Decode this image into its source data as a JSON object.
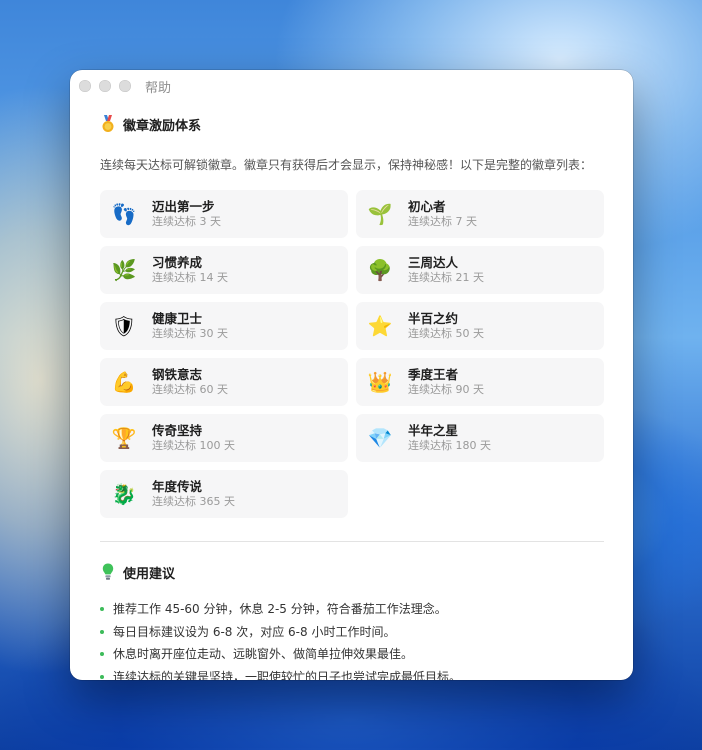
{
  "window": {
    "title": "帮助"
  },
  "badges_section": {
    "title": "徽章激励体系",
    "icon": "medal-icon",
    "intro": "连续每天达标可解锁徽章。徽章只有获得后才会显示，保持神秘感！以下是完整的徽章列表：",
    "items": [
      {
        "name": "迈出第一步",
        "requirement": "连续达标 3 天",
        "icon": "footprints-icon",
        "glyph": "👣"
      },
      {
        "name": "初心者",
        "requirement": "连续达标 7 天",
        "icon": "seedling-icon",
        "glyph": "🌱"
      },
      {
        "name": "习惯养成",
        "requirement": "连续达标 14 天",
        "icon": "herb-icon",
        "glyph": "🌿"
      },
      {
        "name": "三周达人",
        "requirement": "连续达标 21 天",
        "icon": "tree-icon",
        "glyph": "🌳"
      },
      {
        "name": "健康卫士",
        "requirement": "连续达标 30 天",
        "icon": "shield-icon",
        "glyph": "🛡"
      },
      {
        "name": "半百之约",
        "requirement": "连续达标 50 天",
        "icon": "star-icon",
        "glyph": "⭐"
      },
      {
        "name": "钢铁意志",
        "requirement": "连续达标 60 天",
        "icon": "flexed-biceps-icon",
        "glyph": "💪"
      },
      {
        "name": "季度王者",
        "requirement": "连续达标 90 天",
        "icon": "crown-icon",
        "glyph": "👑"
      },
      {
        "name": "传奇坚持",
        "requirement": "连续达标 100 天",
        "icon": "trophy-icon",
        "glyph": "🏆"
      },
      {
        "name": "半年之星",
        "requirement": "连续达标 180 天",
        "icon": "gem-icon",
        "glyph": "💎"
      },
      {
        "name": "年度传说",
        "requirement": "连续达标 365 天",
        "icon": "dragon-icon",
        "glyph": "🐉"
      }
    ]
  },
  "tips_section": {
    "title": "使用建议",
    "icon": "lightbulb-icon",
    "items": [
      "推荐工作 45-60 分钟，休息 2-5 分钟，符合番茄工作法理念。",
      "每日目标建议设为 6-8 次，对应 6-8 小时工作时间。",
      "休息时离开座位走动、远眺窗外、做简单拉伸效果最佳。",
      "连续达标的关键是坚持，一职使较忙的日子也尝试完成最低目标。"
    ]
  },
  "colors": {
    "bullet": "#3dbb5a",
    "card_bg": "#f6f6f7",
    "window_bg": "#ffffff"
  }
}
